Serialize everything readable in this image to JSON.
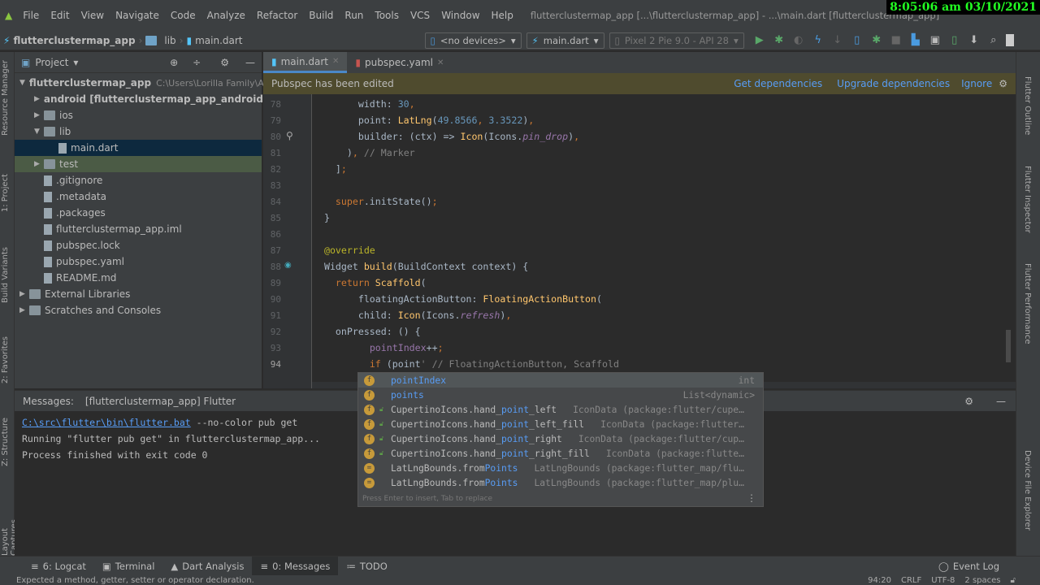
{
  "clock": "8:05:06 am 03/10/2021",
  "menu": [
    "File",
    "Edit",
    "View",
    "Navigate",
    "Code",
    "Analyze",
    "Refactor",
    "Build",
    "Run",
    "Tools",
    "VCS",
    "Window",
    "Help"
  ],
  "window_title": "flutterclustermap_app [...\\flutterclustermap_app] - ...\\main.dart [flutterclustermap_app]",
  "breadcrumb": [
    "flutterclustermap_app",
    "lib",
    "main.dart"
  ],
  "toolbar": {
    "device": "<no devices>",
    "run_config": "main.dart",
    "emulator": "Pixel 2 Pie 9.0 - API 28"
  },
  "left_stripe": [
    "Resource Manager",
    "1: Project",
    "Build Variants",
    "2: Favorites",
    "Z: Structure",
    "Layout Captures"
  ],
  "right_stripe": [
    "Flutter Outline",
    "Flutter Inspector",
    "Flutter Performance",
    "Device File Explorer"
  ],
  "project": {
    "title": "Project",
    "tree": [
      {
        "label": "flutterclustermap_app",
        "extra": "C:\\Users\\Lorilla Family\\An",
        "indent": 0,
        "arrow": "▼",
        "bold": true
      },
      {
        "label": "android [flutterclustermap_app_android]",
        "indent": 1,
        "arrow": "▶",
        "bold": true
      },
      {
        "label": "ios",
        "indent": 1,
        "arrow": "▶"
      },
      {
        "label": "lib",
        "indent": 1,
        "arrow": "▼"
      },
      {
        "label": "main.dart",
        "indent": 2,
        "arrow": "",
        "file": true,
        "state": "sel"
      },
      {
        "label": "test",
        "indent": 1,
        "arrow": "▶",
        "state": "hl"
      },
      {
        "label": ".gitignore",
        "indent": 1,
        "arrow": "",
        "file": true
      },
      {
        "label": ".metadata",
        "indent": 1,
        "arrow": "",
        "file": true
      },
      {
        "label": ".packages",
        "indent": 1,
        "arrow": "",
        "file": true
      },
      {
        "label": "flutterclustermap_app.iml",
        "indent": 1,
        "arrow": "",
        "file": true
      },
      {
        "label": "pubspec.lock",
        "indent": 1,
        "arrow": "",
        "file": true
      },
      {
        "label": "pubspec.yaml",
        "indent": 1,
        "arrow": "",
        "file": true
      },
      {
        "label": "README.md",
        "indent": 1,
        "arrow": "",
        "file": true
      },
      {
        "label": "External Libraries",
        "indent": 0,
        "arrow": "▶"
      },
      {
        "label": "Scratches and Consoles",
        "indent": 0,
        "arrow": "▶"
      }
    ]
  },
  "tabs": [
    {
      "label": "main.dart",
      "active": true
    },
    {
      "label": "pubspec.yaml",
      "active": false
    }
  ],
  "notification": {
    "text": "Pubspec has been edited",
    "actions": [
      "Get dependencies",
      "Upgrade dependencies",
      "Ignore"
    ]
  },
  "code": [
    {
      "n": "78",
      "t": [
        [
          "        width: ",
          ""
        ],
        [
          "30",
          "num"
        ],
        [
          ",",
          "pu"
        ]
      ]
    },
    {
      "n": "79",
      "t": [
        [
          "        point: ",
          ""
        ],
        [
          "LatLng",
          "fn"
        ],
        [
          "(",
          ""
        ],
        [
          "49.8566",
          "num"
        ],
        [
          ", ",
          "pu"
        ],
        [
          "3.3522",
          "num"
        ],
        [
          ")",
          ""
        ],
        [
          ",",
          "pu"
        ]
      ]
    },
    {
      "n": "80",
      "t": [
        [
          "        builder: (ctx) => ",
          ""
        ],
        [
          "Icon",
          "fn"
        ],
        [
          "(Icons.",
          ""
        ],
        [
          "pin_drop",
          "it"
        ],
        [
          ")",
          ""
        ],
        [
          ",",
          "pu"
        ]
      ]
    },
    {
      "n": "81",
      "t": [
        [
          "      )",
          ""
        ],
        [
          ", ",
          "pu"
        ],
        [
          "// Marker",
          "cm"
        ]
      ]
    },
    {
      "n": "82",
      "t": [
        [
          "    ]",
          ""
        ],
        [
          ";",
          "pu"
        ]
      ]
    },
    {
      "n": "83",
      "t": []
    },
    {
      "n": "84",
      "t": [
        [
          "    ",
          ""
        ],
        [
          "super",
          "kw"
        ],
        [
          ".initState()",
          ""
        ],
        [
          ";",
          "pu"
        ]
      ]
    },
    {
      "n": "85",
      "t": [
        [
          "  }",
          ""
        ]
      ]
    },
    {
      "n": "86",
      "t": []
    },
    {
      "n": "87",
      "t": [
        [
          "  ",
          ""
        ],
        [
          "@override",
          "an"
        ]
      ]
    },
    {
      "n": "88",
      "t": [
        [
          "  Widget ",
          ""
        ],
        [
          "build",
          "fn"
        ],
        [
          "(BuildContext context) {",
          ""
        ]
      ]
    },
    {
      "n": "89",
      "t": [
        [
          "    ",
          ""
        ],
        [
          "return ",
          "kw"
        ],
        [
          "Scaffold",
          "fn"
        ],
        [
          "(",
          ""
        ]
      ]
    },
    {
      "n": "90",
      "t": [
        [
          "        floatingActionButton: ",
          ""
        ],
        [
          "FloatingActionButton",
          "fn"
        ],
        [
          "(",
          ""
        ]
      ]
    },
    {
      "n": "91",
      "t": [
        [
          "        child: ",
          ""
        ],
        [
          "Icon",
          "fn"
        ],
        [
          "(Icons.",
          ""
        ],
        [
          "refresh",
          "it"
        ],
        [
          ")",
          ""
        ],
        [
          ",",
          "pu"
        ]
      ]
    },
    {
      "n": "92",
      "t": [
        [
          "    onPressed: () {",
          ""
        ]
      ]
    },
    {
      "n": "93",
      "t": [
        [
          "          ",
          ""
        ],
        [
          "pointIndex",
          "fld"
        ],
        [
          "++",
          ""
        ],
        [
          ";",
          "pu"
        ]
      ]
    },
    {
      "n": "94",
      "t": [
        [
          "          ",
          ""
        ],
        [
          "if ",
          "kw"
        ],
        [
          "(point",
          ""
        ],
        [
          "' // FloatingActionButton, Scaffold",
          "cm"
        ]
      ]
    }
  ],
  "completion": {
    "items": [
      {
        "pre": "",
        "match": "pointIndex",
        "post": "",
        "type": "int",
        "right": true,
        "icon": "f"
      },
      {
        "pre": "",
        "match": "points",
        "post": "",
        "type": "List<dynamic>",
        "right": true,
        "icon": "f"
      },
      {
        "pre": "CupertinoIcons.hand_",
        "match": "point",
        "post": "_left",
        "type": "IconData (package:flutter/cupe…",
        "icon": "f",
        "lock": true
      },
      {
        "pre": "CupertinoIcons.hand_",
        "match": "point",
        "post": "_left_fill",
        "type": "IconData (package:flutter…",
        "icon": "f",
        "lock": true
      },
      {
        "pre": "CupertinoIcons.hand_",
        "match": "point",
        "post": "_right",
        "type": "IconData (package:flutter/cup…",
        "icon": "f",
        "lock": true
      },
      {
        "pre": "CupertinoIcons.hand_",
        "match": "point",
        "post": "_right_fill",
        "type": "IconData (package:flutte…",
        "icon": "f",
        "lock": true
      },
      {
        "pre": "LatLngBounds.from",
        "match": "Points",
        "post": "",
        "type": "LatLngBounds (package:flutter_map/flu…",
        "icon": "="
      },
      {
        "pre": "LatLngBounds.from",
        "match": "Points",
        "post": "",
        "type": "LatLngBounds (package:flutter_map/plu…",
        "icon": "="
      }
    ],
    "footer": "Press Enter to insert, Tab to replace"
  },
  "messages": {
    "title": "Messages:",
    "tab": "[flutterclustermap_app] Flutter",
    "lines": [
      {
        "link": "C:\\src\\flutter\\bin\\flutter.bat",
        "text": " --no-color pub get"
      },
      {
        "text": "Running \"flutter pub get\" in flutterclustermap_app..."
      },
      {
        "text": "Process finished with exit code 0"
      }
    ]
  },
  "bottom_tabs": [
    {
      "label": "6: Logcat"
    },
    {
      "label": "Terminal"
    },
    {
      "label": "Dart Analysis"
    },
    {
      "label": "0: Messages",
      "active": true
    },
    {
      "label": "TODO"
    }
  ],
  "event_log": "Event Log",
  "status": {
    "message": "Expected a method, getter, setter or operator declaration.",
    "position": "94:20",
    "line_sep": "CRLF",
    "encoding": "UTF-8",
    "indent": "2 spaces"
  }
}
